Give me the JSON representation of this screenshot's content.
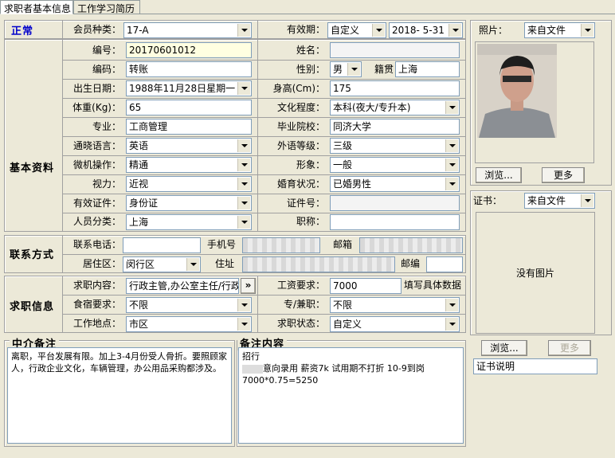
{
  "tabs": [
    {
      "label": "求职者基本信息",
      "active": true
    },
    {
      "label": "工作学习简历",
      "active": false
    }
  ],
  "status": {
    "label": "正常",
    "color": "#0000cc"
  },
  "membership": {
    "label": "会员种类：",
    "value": "17-A"
  },
  "validity": {
    "label": "有效期：",
    "mode": "自定义",
    "date": "2018- 5-31"
  },
  "sections": {
    "basic": "基本资料",
    "contact": "联系方式",
    "job": "求职信息",
    "agent_notes": "中介备注",
    "notes": "备注内容"
  },
  "basic": {
    "number": {
      "label": "编号：",
      "value": "20170601012"
    },
    "code": {
      "label": "编码：",
      "value": "转账"
    },
    "birth": {
      "label": "出生日期：",
      "value": "1988年11月28日星期一"
    },
    "weight": {
      "label": "体重(Kg)：",
      "value": "65"
    },
    "major": {
      "label": "专业：",
      "value": "工商管理"
    },
    "language": {
      "label": "通晓语言：",
      "value": "英语"
    },
    "computer": {
      "label": "微机操作：",
      "value": "精通"
    },
    "vision": {
      "label": "视力：",
      "value": "近视"
    },
    "id_type": {
      "label": "有效证件：",
      "value": "身份证"
    },
    "category": {
      "label": "人员分类：",
      "value": "上海"
    },
    "name": {
      "label": "姓名：",
      "value": ""
    },
    "gender": {
      "label": "性别：",
      "value": "男"
    },
    "native": {
      "label": "籍贯",
      "value": "上海"
    },
    "height": {
      "label": "身高(Cm)：",
      "value": "175"
    },
    "education": {
      "label": "文化程度：",
      "value": "本科(夜大/专升本)"
    },
    "school": {
      "label": "毕业院校：",
      "value": "同济大学"
    },
    "lang_level": {
      "label": "外语等级：",
      "value": "三级"
    },
    "image": {
      "label": "形象：",
      "value": "一般"
    },
    "marital": {
      "label": "婚育状况：",
      "value": "已婚男性"
    },
    "id_no": {
      "label": "证件号：",
      "value": ""
    },
    "title": {
      "label": "职称：",
      "value": ""
    }
  },
  "contact": {
    "phone": {
      "label": "联系电话：",
      "value": ""
    },
    "mobile": {
      "label": "手机号",
      "value": ""
    },
    "email": {
      "label": "邮箱",
      "value": ""
    },
    "district": {
      "label": "居住区：",
      "value": "闵行区"
    },
    "address": {
      "label": "住址",
      "value": ""
    },
    "zip": {
      "label": "邮编",
      "value": ""
    }
  },
  "job": {
    "intent": {
      "label": "求职内容：",
      "value": "行政主管,办公室主任/行政"
    },
    "expand": "»",
    "salary": {
      "label": "工资要求：",
      "value": "7000"
    },
    "salary_hint": "填写具体数据",
    "lodging": {
      "label": "食宿要求：",
      "value": "不限"
    },
    "parttime": {
      "label": "专/兼职：",
      "value": "不限"
    },
    "location": {
      "label": "工作地点：",
      "value": "市区"
    },
    "state": {
      "label": "求职状态：",
      "value": "自定义"
    }
  },
  "agent_notes_text": "离职，平台发展有限。加上3-4月份受人骨折。要照顾家人，行政企业文化，车辆管理，办公用品采购都涉及。",
  "notes_lines": [
    "招行",
    "意向录用   薪资7k   试用期不打折   10-9到岗",
    "7000*0.75=5250"
  ],
  "photo": {
    "label": "照片：",
    "source": "来自文件",
    "browse": "浏览...",
    "more": "更多"
  },
  "cert": {
    "label": "证书：",
    "source": "来自文件",
    "empty": "没有图片",
    "browse": "浏览...",
    "more": "更多",
    "desc": "证书说明"
  }
}
